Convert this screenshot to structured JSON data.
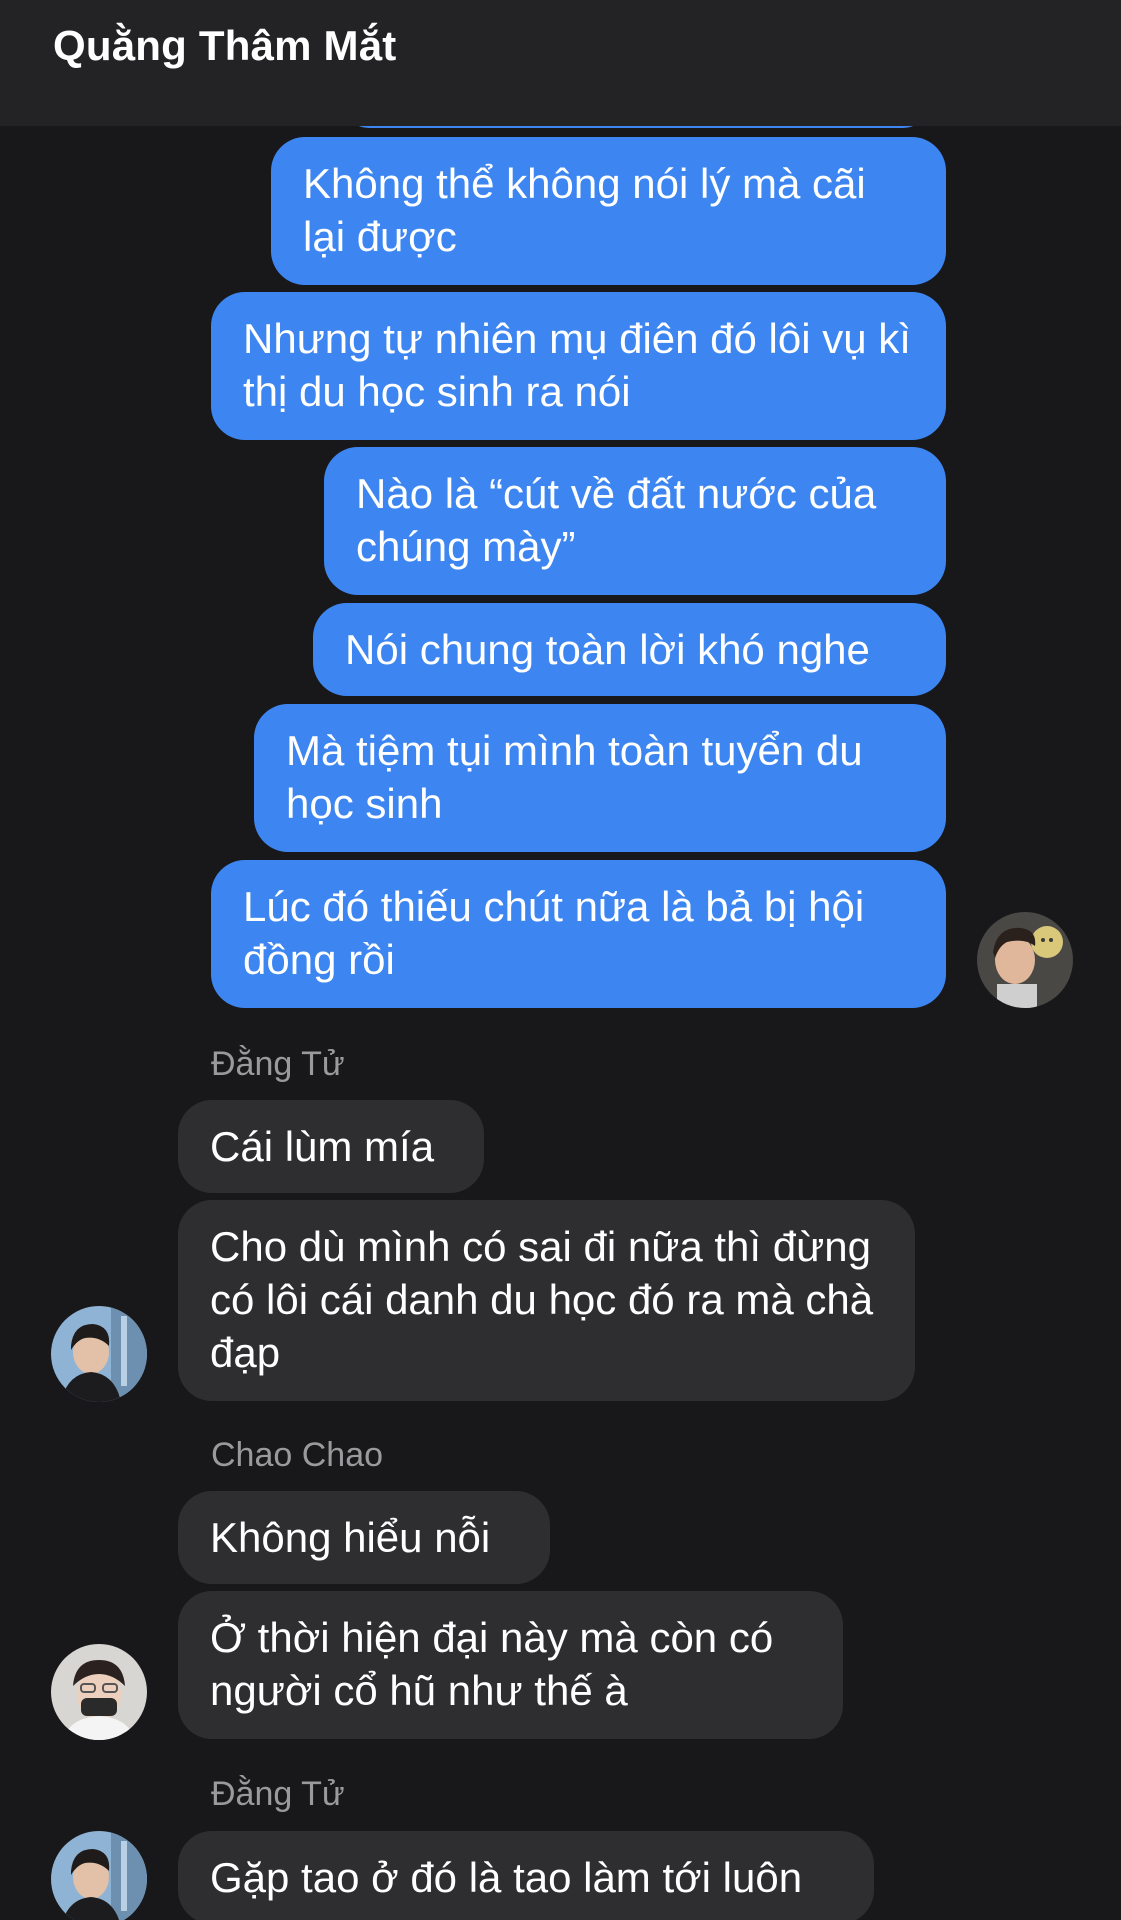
{
  "header": {
    "title": "Quằng Thâm Mắt"
  },
  "outgoing": [
    "Không thể không nói lý mà cãi lại được",
    "Nhưng tự nhiên mụ điên đó lôi vụ kì thị du học sinh ra nói",
    "Nào là “cút về đất nước của chúng mày”",
    "Nói chung toàn lời khó nghe",
    "Mà tiệm tụi mình toàn tuyển du học sinh",
    "Lúc đó thiếu chút nữa là bả bị hội đồng rồi"
  ],
  "groups": [
    {
      "sender": "Đằng Tử",
      "messages": [
        "Cái lùm mía",
        "Cho dù mình có sai đi nữa thì đừng có lôi cái danh du học đó ra mà chà đạp"
      ]
    },
    {
      "sender": "Chao Chao",
      "messages": [
        "Không hiểu nỗi",
        "Ở thời hiện đại này mà còn có người cổ hũ như thế à"
      ]
    },
    {
      "sender": "Đằng Tử",
      "messages": [
        "Gặp tao ở đó là tao làm tới luôn"
      ]
    }
  ],
  "colors": {
    "background": "#18181a",
    "header": "#232325",
    "outgoing_bubble": "#3d86f2",
    "incoming_bubble": "#2e2e30",
    "sender_name": "#9a9a9d"
  }
}
